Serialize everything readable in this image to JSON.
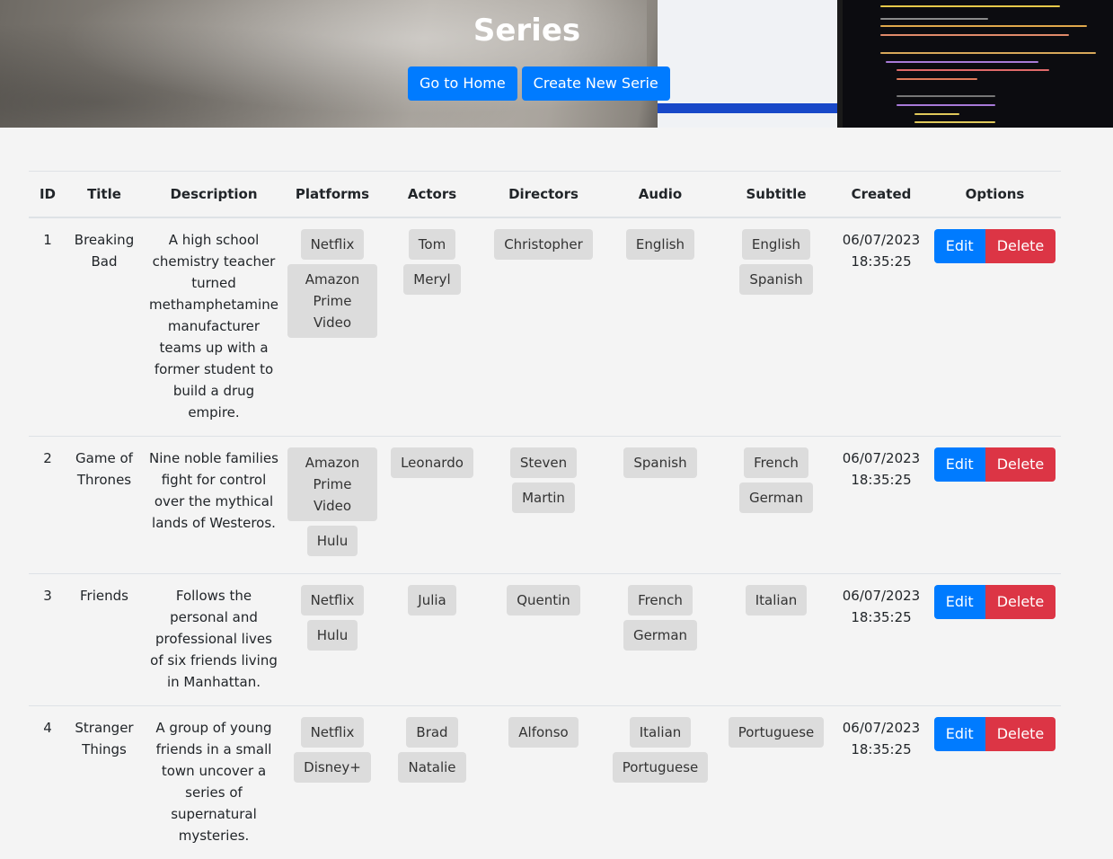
{
  "header": {
    "title": "Series",
    "home_button": "Go to Home",
    "create_button": "Create New Serie"
  },
  "table": {
    "columns": [
      "ID",
      "Title",
      "Description",
      "Platforms",
      "Actors",
      "Directors",
      "Audio",
      "Subtitle",
      "Created",
      "Options"
    ],
    "rows": [
      {
        "id": "1",
        "title": "Breaking Bad",
        "description": "A high school chemistry teacher turned methamphetamine manufacturer teams up with a former student to build a drug empire.",
        "platforms": [
          "Netflix",
          "Amazon Prime Video"
        ],
        "actors": [
          "Tom",
          "Meryl"
        ],
        "directors": [
          "Christopher"
        ],
        "audio": [
          "English"
        ],
        "subtitle": [
          "English",
          "Spanish"
        ],
        "created_date": "06/07/2023",
        "created_time": "18:35:25",
        "edit_label": "Edit",
        "delete_label": "Delete"
      },
      {
        "id": "2",
        "title": "Game of Thrones",
        "description": "Nine noble families fight for control over the mythical lands of Westeros.",
        "platforms": [
          "Amazon Prime Video",
          "Hulu"
        ],
        "actors": [
          "Leonardo"
        ],
        "directors": [
          "Steven",
          "Martin"
        ],
        "audio": [
          "Spanish"
        ],
        "subtitle": [
          "French",
          "German"
        ],
        "created_date": "06/07/2023",
        "created_time": "18:35:25",
        "edit_label": "Edit",
        "delete_label": "Delete"
      },
      {
        "id": "3",
        "title": "Friends",
        "description": "Follows the personal and professional lives of six friends living in Manhattan.",
        "platforms": [
          "Netflix",
          "Hulu"
        ],
        "actors": [
          "Julia"
        ],
        "directors": [
          "Quentin"
        ],
        "audio": [
          "French",
          "German"
        ],
        "subtitle": [
          "Italian"
        ],
        "created_date": "06/07/2023",
        "created_time": "18:35:25",
        "edit_label": "Edit",
        "delete_label": "Delete"
      },
      {
        "id": "4",
        "title": "Stranger Things",
        "description": "A group of young friends in a small town uncover a series of supernatural mysteries.",
        "platforms": [
          "Netflix",
          "Disney+"
        ],
        "actors": [
          "Brad",
          "Natalie"
        ],
        "directors": [
          "Alfonso"
        ],
        "audio": [
          "Italian",
          "Portuguese"
        ],
        "subtitle": [
          "Portuguese"
        ],
        "created_date": "06/07/2023",
        "created_time": "18:35:25",
        "edit_label": "Edit",
        "delete_label": "Delete"
      }
    ]
  },
  "colors": {
    "primary": "#007bff",
    "danger": "#dc3545",
    "tag_bg": "#dcdcdc",
    "page_bg": "#f4f4f4"
  }
}
